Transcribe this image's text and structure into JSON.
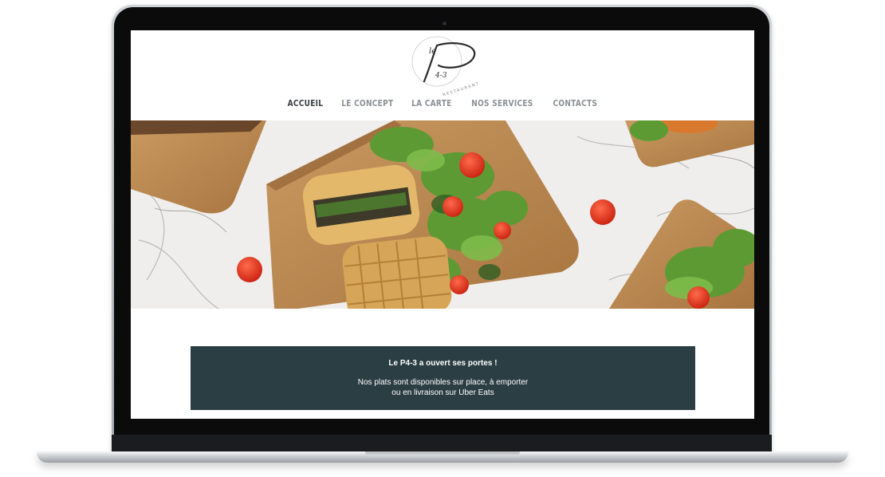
{
  "brand": {
    "logo_text": "le P4-3",
    "logo_subtitle": "RESTAURANT"
  },
  "nav": {
    "items": [
      {
        "label": "ACCUEIL",
        "active": true
      },
      {
        "label": "LE CONCEPT",
        "active": false
      },
      {
        "label": "LA CARTE",
        "active": false
      },
      {
        "label": "NOS SERVICES",
        "active": false
      },
      {
        "label": "CONTACTS",
        "active": false
      }
    ]
  },
  "hero": {
    "image": "food-photo-waffles-salad-cherry-tomatoes-on-wooden-boards-marble-table"
  },
  "banner": {
    "title": "Le P4-3 a ouvert ses portes !",
    "line1": "Nos plats sont disponibles sur place, à emporter",
    "line2": "ou en livraison sur Uber Eats"
  },
  "colors": {
    "banner_bg": "#2b3e44",
    "nav_active": "#3a3d41",
    "nav_inactive": "#8b8f94",
    "laptop_bezel": "#0b0b0c"
  }
}
